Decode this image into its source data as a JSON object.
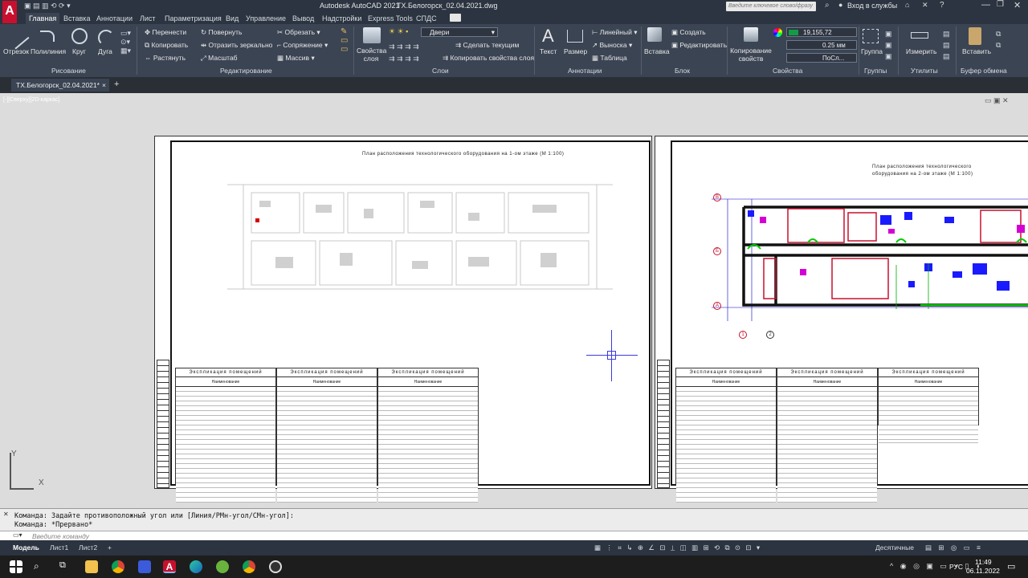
{
  "title_bar": {
    "app_title": "Autodesk AutoCAD 2021",
    "file_title": "ТХ.Белогорск_02.04.2021.dwg",
    "search_placeholder": "Введите ключевое слово/фразу",
    "sign_in": "Вход в службы"
  },
  "ribbon_tabs": [
    "Главная",
    "Вставка",
    "Аннотации",
    "Лист",
    "Параметризация",
    "Вид",
    "Управление",
    "Вывод",
    "Надстройки",
    "Express Tools",
    "СПДС"
  ],
  "ribbon": {
    "draw": {
      "line": "Отрезок",
      "polyline": "Полилиния",
      "circle": "Круг",
      "arc": "Дуга",
      "panel": "Рисование"
    },
    "modify": {
      "move": "Перенести",
      "rotate": "Повернуть",
      "trim": "Обрезать",
      "copy": "Копировать",
      "mirror": "Отразить зеркально",
      "fillet": "Сопряжение",
      "stretch": "Растянуть",
      "scale": "Масштаб",
      "array": "Массив",
      "panel": "Редактирование"
    },
    "layers": {
      "layer_props": "Свойства слоя",
      "current_layer": "Двери",
      "make_current": "Сделать текущим",
      "match_layer": "Копировать свойства слоя",
      "panel": "Слои"
    },
    "annotation": {
      "text": "Текст",
      "dimension": "Размер",
      "linear": "Линейный",
      "leader": "Выноска",
      "table": "Таблица",
      "panel": "Аннотации"
    },
    "block": {
      "insert": "Вставка",
      "create": "Создать",
      "edit": "Редактировать",
      "panel": "Блок"
    },
    "properties": {
      "match": "Копирование свойств",
      "color": "19,155,72",
      "lineweight": "0.25 мм",
      "linetype": "ПоСл...",
      "panel": "Свойства"
    },
    "groups": {
      "group": "Группа",
      "panel": "Группы"
    },
    "utilities": {
      "measure": "Измерить",
      "panel": "Утилиты"
    },
    "clipboard": {
      "paste": "Вставить",
      "panel": "Буфер обмена"
    }
  },
  "doc_tab": "ТХ.Белогорск_02.04.2021*",
  "viewport_label": "[-][Сверху][2D-каркас]",
  "drawing": {
    "sheet1_title": "План расположения технологического оборудования на 1-ом этаже (М 1:100)",
    "sheet2_title": "План расположения технологического оборудования на 2-ом этаже (М 1:100)",
    "table_title": "Экспликация помещений",
    "col_name": "Наименование",
    "axis_labels": [
      "В",
      "Б",
      "А"
    ],
    "axis_nums": [
      "1",
      "2"
    ]
  },
  "command": {
    "line1": "Команда: Задайте противоположный угол или [Линия/РМн-угол/СМн-угол]:",
    "line2": "Команда: *Прервано*",
    "placeholder": "Введите команду"
  },
  "layout_tabs": [
    "Модель",
    "Лист1",
    "Лист2"
  ],
  "status": {
    "units": "Десятичные"
  },
  "taskbar": {
    "lang": "РУС",
    "time": "11:49",
    "date": "06.11.2022"
  },
  "colors": {
    "accent_red": "#c8102e",
    "ribbon_bg": "#3b4453",
    "title_bg": "#2b3440"
  }
}
